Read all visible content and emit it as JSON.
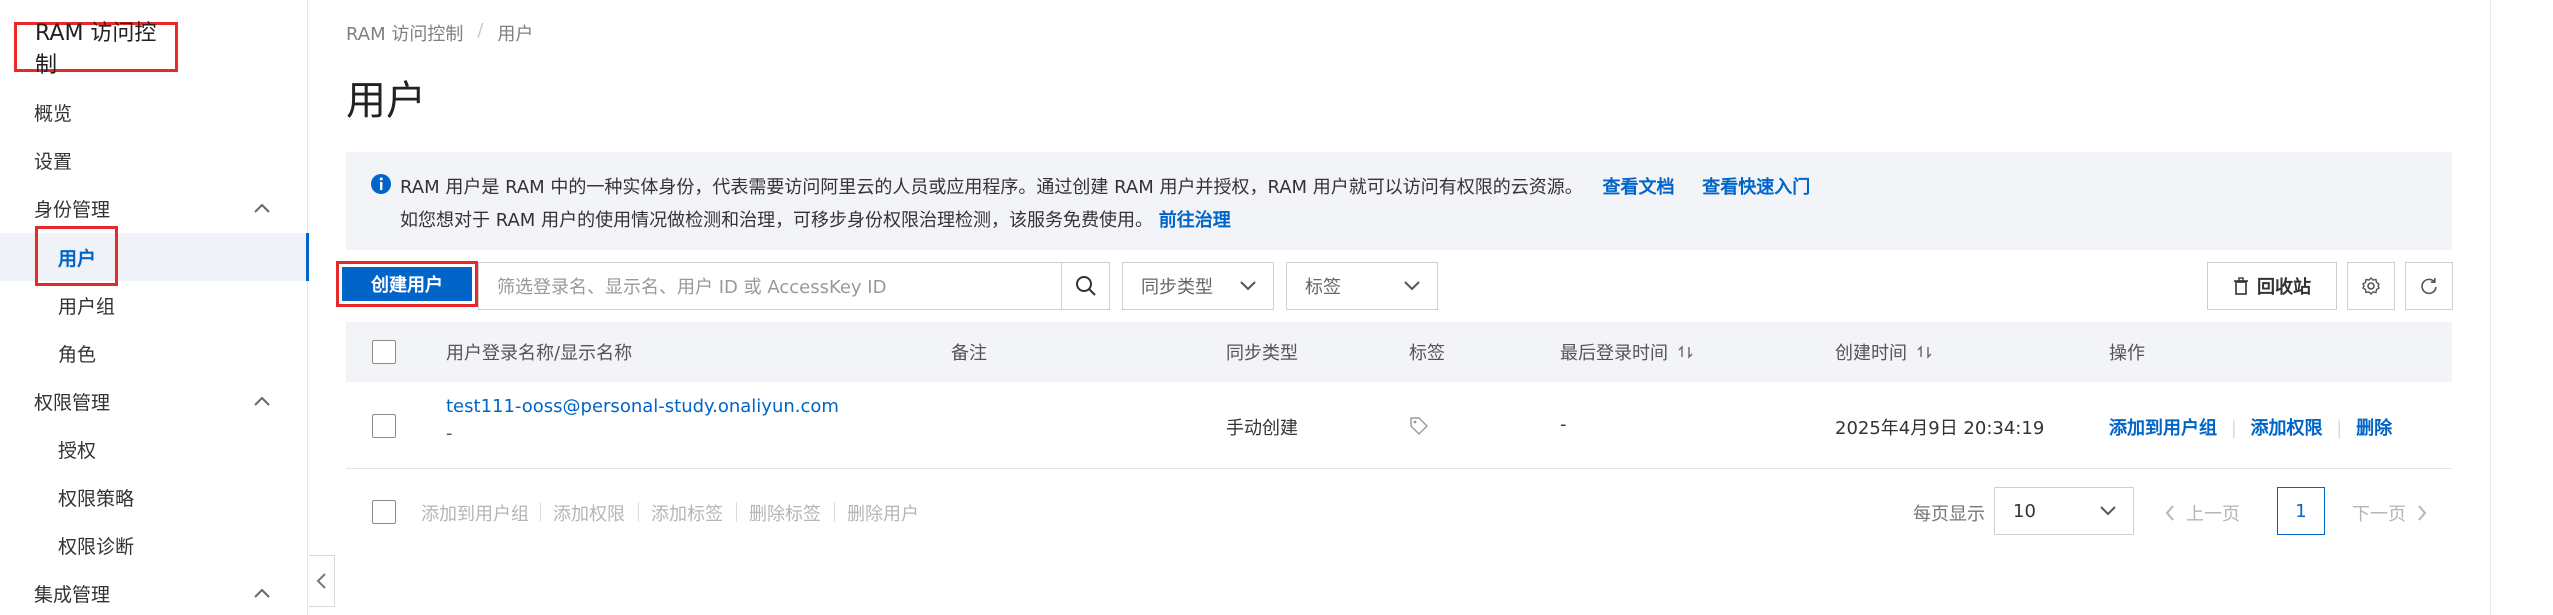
{
  "sidebar": {
    "brand": "RAM 访问控制",
    "items": [
      {
        "label": "概览"
      },
      {
        "label": "设置"
      },
      {
        "label": "身份管理"
      },
      {
        "label": "用户"
      },
      {
        "label": "用户组"
      },
      {
        "label": "角色"
      },
      {
        "label": "权限管理"
      },
      {
        "label": "授权"
      },
      {
        "label": "权限策略"
      },
      {
        "label": "权限诊断"
      },
      {
        "label": "集成管理"
      }
    ]
  },
  "breadcrumb": {
    "root": "RAM 访问控制",
    "separator": "/",
    "current": "用户"
  },
  "page": {
    "title": "用户"
  },
  "notice": {
    "text1": "RAM 用户是 RAM 中的一种实体身份，代表需要访问阿里云的人员或应用程序。通过创建 RAM 用户并授权，RAM 用户就可以访问有权限的云资源。",
    "link1": "查看文档",
    "link2": "查看快速入门",
    "text2": "如您想对于 RAM 用户的使用情况做检测和治理，可移步身份权限治理检测，该服务免费使用。",
    "link3": "前往治理"
  },
  "toolbar": {
    "create_label": "创建用户",
    "search_placeholder": "筛选登录名、显示名、用户 ID 或 AccessKey ID",
    "sync_type": "同步类型",
    "tag": "标签",
    "recycle": "回收站"
  },
  "table": {
    "columns": {
      "login": "用户登录名称/显示名称",
      "note": "备注",
      "sync": "同步类型",
      "tag": "标签",
      "last_login": "最后登录时间",
      "created": "创建时间",
      "ops": "操作"
    },
    "rows": [
      {
        "login": "test111-ooss@personal-study.onaliyun.com",
        "display": "-",
        "sync": "手动创建",
        "last_login": "-",
        "created": "2025年4月9日 20:34:19",
        "op_add_group": "添加到用户组",
        "op_add_perm": "添加权限",
        "op_delete": "删除"
      }
    ]
  },
  "batch": {
    "add_group": "添加到用户组",
    "add_perm": "添加权限",
    "add_tag": "添加标签",
    "del_tag": "删除标签",
    "del_user": "删除用户"
  },
  "pagination": {
    "page_size_label": "每页显示",
    "page_size": "10",
    "prev": "上一页",
    "current": "1",
    "next": "下一页"
  },
  "colors": {
    "primary": "#0064c8",
    "highlight": "#e8292c",
    "panel": "#f2f4f7"
  }
}
